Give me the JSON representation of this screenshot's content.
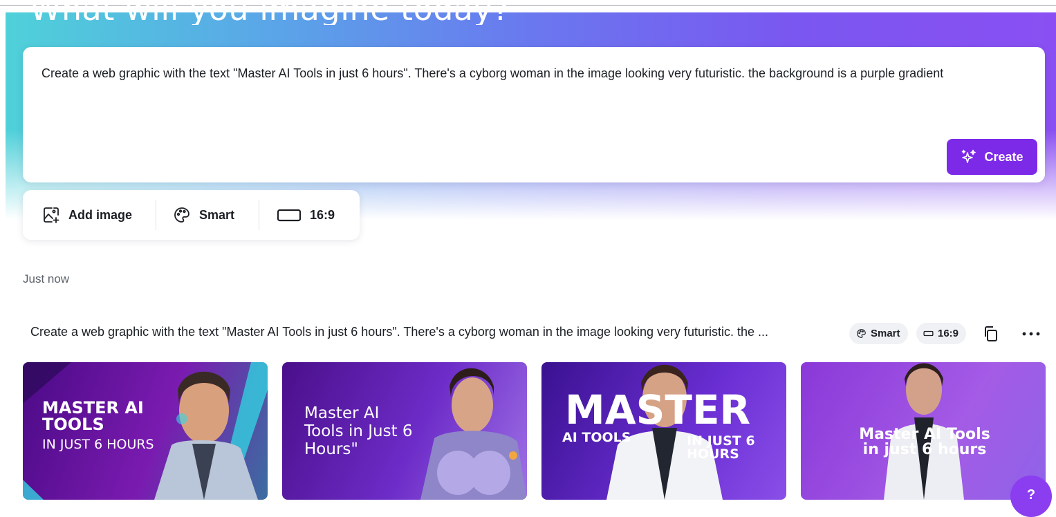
{
  "hero": {
    "title": "What will you imagine today?"
  },
  "prompt": {
    "value": "Create a web graphic with the text \"Master AI Tools in just 6 hours\". There's a cyborg woman in the image looking very futuristic. the background is a purple gradient",
    "create_label": "Create"
  },
  "options": {
    "add_image_label": "Add image",
    "style_label": "Smart",
    "ratio_label": "16:9"
  },
  "history": {
    "timestamp": "Just now",
    "prompt_truncated": "Create a web graphic with the text \"Master AI Tools in just 6 hours\". There's a cyborg woman in the image looking very futuristic. the ...",
    "style_chip": "Smart",
    "ratio_chip": "16:9"
  },
  "results": [
    {
      "line1": "MASTER AI TOOLS",
      "line2": "IN JUST 6 HOURS"
    },
    {
      "line1": "Master AI Tools in Just 6 Hours\""
    },
    {
      "line1": "MASTER",
      "line2": "AI TOOLS",
      "line3": "IN JUST 6 HOURS"
    },
    {
      "line1": "Master AI Tools in just 6 hours"
    }
  ],
  "help": {
    "label": "?"
  },
  "colors": {
    "accent": "#7d2ae8",
    "help": "#8b3df0"
  },
  "icons": [
    "sparkle-icon",
    "add-image-icon",
    "palette-icon",
    "aspect-ratio-icon",
    "copy-icon",
    "more-icon"
  ]
}
